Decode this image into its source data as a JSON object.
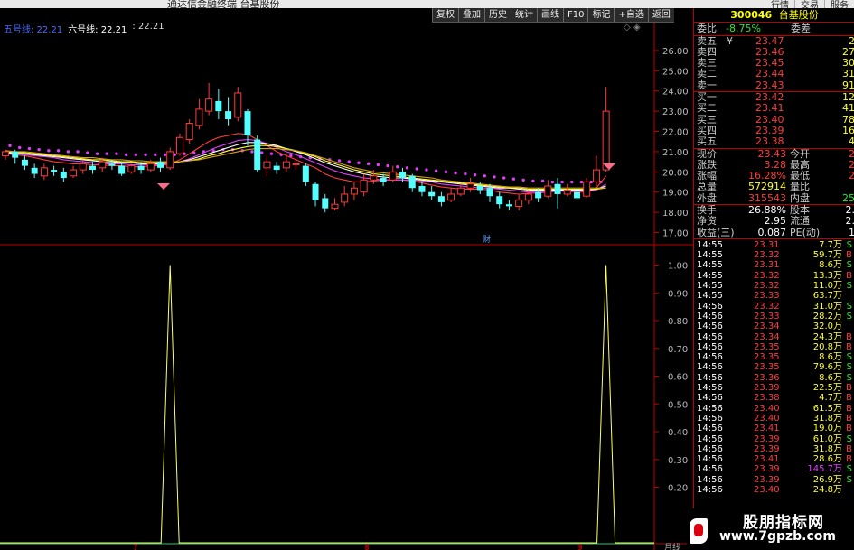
{
  "window": {
    "title": "通达信金融终端 台基股份"
  },
  "top_menu": [
    "行情",
    "交易",
    "服务"
  ],
  "toolbar": [
    "复权",
    "叠加",
    "历史",
    "统计",
    "画线",
    "F10",
    "标记",
    "+自选",
    "返回"
  ],
  "ma_legend": {
    "ma5": "五号线: 22.21",
    "ma6": "六号线: 22.21",
    "ma7": ": 22.21"
  },
  "chart_controls": "◇ ◈",
  "chart_data": [
    {
      "type": "candlestick",
      "title": "",
      "ylim": [
        16.8,
        26.8
      ],
      "yticks": [
        "26.00",
        "25.00",
        "24.00",
        "23.00",
        "22.00",
        "21.00",
        "20.00",
        "19.00",
        "18.00",
        "17.00"
      ],
      "ytick_values": [
        26,
        25,
        24,
        23,
        22,
        21,
        20,
        19,
        18,
        17
      ],
      "annotation": "财",
      "candles": [
        {
          "o": 20.8,
          "c": 21.0,
          "h": 21.1,
          "l": 20.6
        },
        {
          "o": 21.0,
          "c": 20.7,
          "h": 21.1,
          "l": 20.4
        },
        {
          "o": 20.6,
          "c": 20.3,
          "h": 20.8,
          "l": 20.1
        },
        {
          "o": 20.2,
          "c": 19.9,
          "h": 20.4,
          "l": 19.7
        },
        {
          "o": 19.8,
          "c": 20.2,
          "h": 20.4,
          "l": 19.6
        },
        {
          "o": 20.1,
          "c": 20.0,
          "h": 20.3,
          "l": 19.8
        },
        {
          "o": 20.0,
          "c": 19.7,
          "h": 20.2,
          "l": 19.5
        },
        {
          "o": 19.8,
          "c": 20.1,
          "h": 20.3,
          "l": 19.7
        },
        {
          "o": 20.1,
          "c": 20.4,
          "h": 20.6,
          "l": 19.9
        },
        {
          "o": 20.3,
          "c": 20.1,
          "h": 20.5,
          "l": 19.9
        },
        {
          "o": 20.2,
          "c": 20.5,
          "h": 20.7,
          "l": 20.0
        },
        {
          "o": 20.4,
          "c": 20.3,
          "h": 20.6,
          "l": 20.1
        },
        {
          "o": 20.3,
          "c": 19.9,
          "h": 20.5,
          "l": 19.8
        },
        {
          "o": 20.0,
          "c": 20.3,
          "h": 20.4,
          "l": 19.9
        },
        {
          "o": 20.3,
          "c": 20.1,
          "h": 20.5,
          "l": 19.9
        },
        {
          "o": 20.1,
          "c": 20.4,
          "h": 20.6,
          "l": 20.0
        },
        {
          "o": 20.5,
          "c": 20.2,
          "h": 20.7,
          "l": 20.0
        },
        {
          "o": 20.2,
          "c": 21.0,
          "h": 21.2,
          "l": 20.1
        },
        {
          "o": 20.9,
          "c": 21.7,
          "h": 21.9,
          "l": 20.8
        },
        {
          "o": 21.6,
          "c": 22.4,
          "h": 22.6,
          "l": 21.4
        },
        {
          "o": 22.3,
          "c": 23.1,
          "h": 23.6,
          "l": 22.1
        },
        {
          "o": 23.0,
          "c": 23.6,
          "h": 24.4,
          "l": 22.8
        },
        {
          "o": 23.5,
          "c": 23.0,
          "h": 24.1,
          "l": 22.6
        },
        {
          "o": 23.0,
          "c": 22.6,
          "h": 23.7,
          "l": 22.3
        },
        {
          "o": 22.7,
          "c": 23.9,
          "h": 24.2,
          "l": 22.5
        },
        {
          "o": 23.0,
          "c": 21.8,
          "h": 23.1,
          "l": 21.3
        },
        {
          "o": 21.6,
          "c": 20.1,
          "h": 21.8,
          "l": 20.0
        },
        {
          "o": 20.2,
          "c": 20.5,
          "h": 20.8,
          "l": 19.8
        },
        {
          "o": 20.3,
          "c": 20.1,
          "h": 20.5,
          "l": 19.9
        },
        {
          "o": 20.2,
          "c": 20.5,
          "h": 20.9,
          "l": 20.0
        },
        {
          "o": 20.4,
          "c": 20.4,
          "h": 20.7,
          "l": 20.1
        },
        {
          "o": 20.3,
          "c": 19.5,
          "h": 20.4,
          "l": 19.3
        },
        {
          "o": 19.4,
          "c": 18.6,
          "h": 19.5,
          "l": 18.3
        },
        {
          "o": 18.7,
          "c": 18.2,
          "h": 18.9,
          "l": 18.0
        },
        {
          "o": 18.2,
          "c": 18.4,
          "h": 18.7,
          "l": 18.1
        },
        {
          "o": 18.5,
          "c": 18.9,
          "h": 19.3,
          "l": 18.3
        },
        {
          "o": 18.9,
          "c": 19.2,
          "h": 19.5,
          "l": 18.6
        },
        {
          "o": 19.0,
          "c": 19.6,
          "h": 19.9,
          "l": 18.8
        },
        {
          "o": 19.6,
          "c": 19.8,
          "h": 20.1,
          "l": 19.4
        },
        {
          "o": 19.7,
          "c": 19.5,
          "h": 19.9,
          "l": 19.3
        },
        {
          "o": 19.6,
          "c": 20.0,
          "h": 20.3,
          "l": 19.5
        },
        {
          "o": 20.0,
          "c": 19.7,
          "h": 20.2,
          "l": 19.5
        },
        {
          "o": 19.8,
          "c": 19.2,
          "h": 19.9,
          "l": 19.0
        },
        {
          "o": 19.3,
          "c": 19.0,
          "h": 19.5,
          "l": 18.8
        },
        {
          "o": 19.0,
          "c": 18.8,
          "h": 19.3,
          "l": 18.6
        },
        {
          "o": 18.8,
          "c": 18.5,
          "h": 19.0,
          "l": 18.3
        },
        {
          "o": 18.6,
          "c": 18.9,
          "h": 19.2,
          "l": 18.5
        },
        {
          "o": 18.9,
          "c": 19.2,
          "h": 19.4,
          "l": 18.8
        },
        {
          "o": 19.2,
          "c": 19.4,
          "h": 19.7,
          "l": 19.0
        },
        {
          "o": 19.3,
          "c": 19.1,
          "h": 19.5,
          "l": 18.9
        },
        {
          "o": 19.2,
          "c": 18.8,
          "h": 19.4,
          "l": 18.5
        },
        {
          "o": 18.8,
          "c": 18.4,
          "h": 19.0,
          "l": 18.2
        },
        {
          "o": 18.4,
          "c": 18.3,
          "h": 18.6,
          "l": 18.1
        },
        {
          "o": 18.3,
          "c": 18.6,
          "h": 18.9,
          "l": 18.1
        },
        {
          "o": 18.6,
          "c": 18.9,
          "h": 19.1,
          "l": 18.4
        },
        {
          "o": 19.0,
          "c": 18.7,
          "h": 19.2,
          "l": 18.5
        },
        {
          "o": 18.8,
          "c": 19.3,
          "h": 19.6,
          "l": 18.7
        },
        {
          "o": 19.4,
          "c": 18.9,
          "h": 19.7,
          "l": 18.2
        },
        {
          "o": 18.9,
          "c": 19.1,
          "h": 19.4,
          "l": 18.8
        },
        {
          "o": 19.0,
          "c": 18.7,
          "h": 19.2,
          "l": 18.6
        },
        {
          "o": 18.8,
          "c": 19.5,
          "h": 19.7,
          "l": 18.7
        },
        {
          "o": 19.5,
          "c": 20.1,
          "h": 20.8,
          "l": 19.3
        },
        {
          "o": 20.1,
          "c": 23.0,
          "h": 24.2,
          "l": 20.0
        }
      ],
      "ma_series": [
        {
          "color": "#ff3b3b",
          "values": [
            20.9,
            20.85,
            20.8,
            20.7,
            20.6,
            20.5,
            20.45,
            20.4,
            20.4,
            20.35,
            20.35,
            20.3,
            20.3,
            20.25,
            20.25,
            20.3,
            20.3,
            20.4,
            20.6,
            20.9,
            21.2,
            21.5,
            21.7,
            21.8,
            21.9,
            21.85,
            21.6,
            21.3,
            21.0,
            20.8,
            20.6,
            20.4,
            20.2,
            19.9,
            19.7,
            19.6,
            19.5,
            19.5,
            19.55,
            19.6,
            19.6,
            19.6,
            19.55,
            19.45,
            19.35,
            19.25,
            19.2,
            19.15,
            19.15,
            19.15,
            19.1,
            19.0,
            18.95,
            18.9,
            18.95,
            18.95,
            19.0,
            19.05,
            19.05,
            19.0,
            19.0,
            19.2,
            19.8
          ]
        },
        {
          "color": "#e040fb",
          "values": [
            20.9,
            20.9,
            20.85,
            20.8,
            20.75,
            20.7,
            20.6,
            20.55,
            20.5,
            20.45,
            20.4,
            20.4,
            20.4,
            20.35,
            20.35,
            20.35,
            20.35,
            20.4,
            20.5,
            20.65,
            20.85,
            21.05,
            21.25,
            21.4,
            21.55,
            21.6,
            21.55,
            21.4,
            21.2,
            21.0,
            20.85,
            20.65,
            20.45,
            20.25,
            20.05,
            19.9,
            19.8,
            19.7,
            19.65,
            19.6,
            19.6,
            19.6,
            19.6,
            19.55,
            19.5,
            19.4,
            19.35,
            19.3,
            19.25,
            19.2,
            19.2,
            19.15,
            19.1,
            19.05,
            19.0,
            19.0,
            19.0,
            19.05,
            19.05,
            19.05,
            19.05,
            19.1,
            19.4
          ]
        },
        {
          "color": "#ffffff",
          "values": [
            20.95,
            20.9,
            20.9,
            20.85,
            20.8,
            20.75,
            20.7,
            20.65,
            20.6,
            20.55,
            20.5,
            20.5,
            20.45,
            20.45,
            20.4,
            20.4,
            20.4,
            20.45,
            20.5,
            20.6,
            20.75,
            20.9,
            21.05,
            21.2,
            21.35,
            21.45,
            21.45,
            21.4,
            21.3,
            21.15,
            21.0,
            20.85,
            20.65,
            20.45,
            20.3,
            20.15,
            20.0,
            19.9,
            19.8,
            19.75,
            19.7,
            19.7,
            19.65,
            19.6,
            19.55,
            19.5,
            19.45,
            19.4,
            19.35,
            19.3,
            19.25,
            19.2,
            19.2,
            19.15,
            19.1,
            19.1,
            19.1,
            19.1,
            19.1,
            19.1,
            19.1,
            19.15,
            19.3
          ]
        },
        {
          "color": "#ffff33",
          "values": [
            21.0,
            20.95,
            20.95,
            20.9,
            20.85,
            20.8,
            20.75,
            20.7,
            20.65,
            20.6,
            20.6,
            20.55,
            20.5,
            20.5,
            20.45,
            20.45,
            20.45,
            20.45,
            20.5,
            20.55,
            20.65,
            20.8,
            20.9,
            21.05,
            21.15,
            21.25,
            21.3,
            21.3,
            21.25,
            21.15,
            21.05,
            20.9,
            20.75,
            20.55,
            20.4,
            20.25,
            20.1,
            20.0,
            19.9,
            19.85,
            19.8,
            19.75,
            19.7,
            19.65,
            19.6,
            19.55,
            19.5,
            19.45,
            19.4,
            19.35,
            19.3,
            19.25,
            19.2,
            19.2,
            19.15,
            19.15,
            19.15,
            19.15,
            19.15,
            19.15,
            19.15,
            19.15,
            19.2
          ]
        },
        {
          "color": "#d4a017",
          "values": [
            21.05,
            21.0,
            21.0,
            20.95,
            20.9,
            20.85,
            20.8,
            20.75,
            20.7,
            20.7,
            20.65,
            20.6,
            20.6,
            20.55,
            20.55,
            20.5,
            20.5,
            20.5,
            20.5,
            20.55,
            20.6,
            20.7,
            20.8,
            20.9,
            21.0,
            21.1,
            21.15,
            21.15,
            21.15,
            21.1,
            21.05,
            20.95,
            20.8,
            20.65,
            20.5,
            20.35,
            20.2,
            20.1,
            20.0,
            19.95,
            19.9,
            19.85,
            19.8,
            19.75,
            19.7,
            19.6,
            19.55,
            19.5,
            19.45,
            19.4,
            19.35,
            19.3,
            19.25,
            19.25,
            19.2,
            19.2,
            19.2,
            19.2,
            19.2,
            19.2,
            19.2,
            19.2,
            19.2
          ]
        }
      ]
    },
    {
      "type": "line",
      "title": "",
      "ylim": [
        0,
        1.07
      ],
      "yticks": [
        "1.00",
        "0.90",
        "0.80",
        "0.70",
        "0.60",
        "0.50",
        "0.40",
        "0.30",
        "0.20"
      ],
      "ytick_values": [
        1.0,
        0.9,
        0.8,
        0.7,
        0.6,
        0.5,
        0.4,
        0.3,
        0.2
      ],
      "x_markers": [
        "7",
        "8",
        "9"
      ],
      "spikes_at_candle": [
        17,
        62
      ]
    }
  ],
  "panel": {
    "code": "300046",
    "name": "台基股份",
    "weibi": {
      "label": "委比",
      "value": "-8.75%",
      "label2": "委差"
    },
    "asks": [
      {
        "label": "卖五",
        "mark": "¥",
        "price": "23.47",
        "vol": "2"
      },
      {
        "label": "卖四",
        "mark": "",
        "price": "23.46",
        "vol": "27"
      },
      {
        "label": "卖三",
        "mark": "",
        "price": "23.45",
        "vol": "30"
      },
      {
        "label": "卖二",
        "mark": "",
        "price": "23.44",
        "vol": "31"
      },
      {
        "label": "卖一",
        "mark": "",
        "price": "23.43",
        "vol": "91"
      }
    ],
    "bids": [
      {
        "label": "买一",
        "price": "23.42",
        "vol": "12"
      },
      {
        "label": "买二",
        "price": "23.41",
        "vol": "41"
      },
      {
        "label": "买三",
        "price": "23.40",
        "vol": "78"
      },
      {
        "label": "买四",
        "price": "23.39",
        "vol": "16"
      },
      {
        "label": "买五",
        "price": "23.38",
        "vol": "4"
      }
    ],
    "stats1": [
      {
        "l1": "现价",
        "v1": "23.43",
        "l2": "今开",
        "v2": "2"
      },
      {
        "l1": "涨跌",
        "v1": "3.28",
        "l2": "最高",
        "v2": "2"
      },
      {
        "l1": "涨幅",
        "v1": "16.28%",
        "l2": "最低",
        "v2": "2"
      },
      {
        "l1": "总量",
        "v1": "572914",
        "l2": "量比",
        "v2": ""
      },
      {
        "l1": "外盘",
        "v1": "315543",
        "l2": "内盘",
        "v2": "25"
      }
    ],
    "stats2": [
      {
        "l1": "换手",
        "v1": "26.88%",
        "l2": "股本",
        "v2": "2."
      },
      {
        "l1": "净资",
        "v1": "2.95",
        "l2": "流通",
        "v2": "2."
      },
      {
        "l1": "收益(三)",
        "v1": "0.087",
        "l2": "PE(动)",
        "v2": "1"
      }
    ],
    "trades": [
      {
        "t": "14:55",
        "p": "23.31",
        "v": "7.7万",
        "s": "S"
      },
      {
        "t": "14:55",
        "p": "23.32",
        "v": "59.7万",
        "s": "B"
      },
      {
        "t": "14:55",
        "p": "23.31",
        "v": "8.6万",
        "s": "S"
      },
      {
        "t": "14:55",
        "p": "23.32",
        "v": "13.3万",
        "s": "B"
      },
      {
        "t": "14:55",
        "p": "23.32",
        "v": "11.0万",
        "s": "S"
      },
      {
        "t": "14:55",
        "p": "23.33",
        "v": "63.7万",
        "s": ""
      },
      {
        "t": "14:56",
        "p": "23.32",
        "v": "31.0万",
        "s": "S"
      },
      {
        "t": "14:56",
        "p": "23.33",
        "v": "28.2万",
        "s": "S"
      },
      {
        "t": "14:56",
        "p": "23.34",
        "v": "32.0万",
        "s": ""
      },
      {
        "t": "14:56",
        "p": "23.34",
        "v": "24.3万",
        "s": "B"
      },
      {
        "t": "14:56",
        "p": "23.35",
        "v": "20.8万",
        "s": "B"
      },
      {
        "t": "14:56",
        "p": "23.35",
        "v": "8.6万",
        "s": "S"
      },
      {
        "t": "14:56",
        "p": "23.35",
        "v": "79.6万",
        "s": "S"
      },
      {
        "t": "14:56",
        "p": "23.36",
        "v": "8.6万",
        "s": "S"
      },
      {
        "t": "14:56",
        "p": "23.39",
        "v": "22.5万",
        "s": "B"
      },
      {
        "t": "14:56",
        "p": "23.38",
        "v": "4.7万",
        "s": "B"
      },
      {
        "t": "14:56",
        "p": "23.40",
        "v": "61.5万",
        "s": "B"
      },
      {
        "t": "14:56",
        "p": "23.40",
        "v": "31.8万",
        "s": "B"
      },
      {
        "t": "14:56",
        "p": "23.41",
        "v": "19.0万",
        "s": "B"
      },
      {
        "t": "14:56",
        "p": "23.39",
        "v": "61.0万",
        "s": "S"
      },
      {
        "t": "14:56",
        "p": "23.39",
        "v": "31.8万",
        "s": "B"
      },
      {
        "t": "14:56",
        "p": "23.41",
        "v": "28.6万",
        "s": "B"
      },
      {
        "t": "14:56",
        "p": "23.39",
        "v": "145.7万",
        "s": "S"
      },
      {
        "t": "14:56",
        "p": "23.39",
        "v": "26.9万",
        "s": "S"
      },
      {
        "t": "14:56",
        "p": "23.40",
        "v": "24.8万",
        "s": ""
      }
    ]
  },
  "watermark": {
    "line1": "股朋指标网",
    "line2": "www.7gpzb.com"
  },
  "month_label": "月线"
}
